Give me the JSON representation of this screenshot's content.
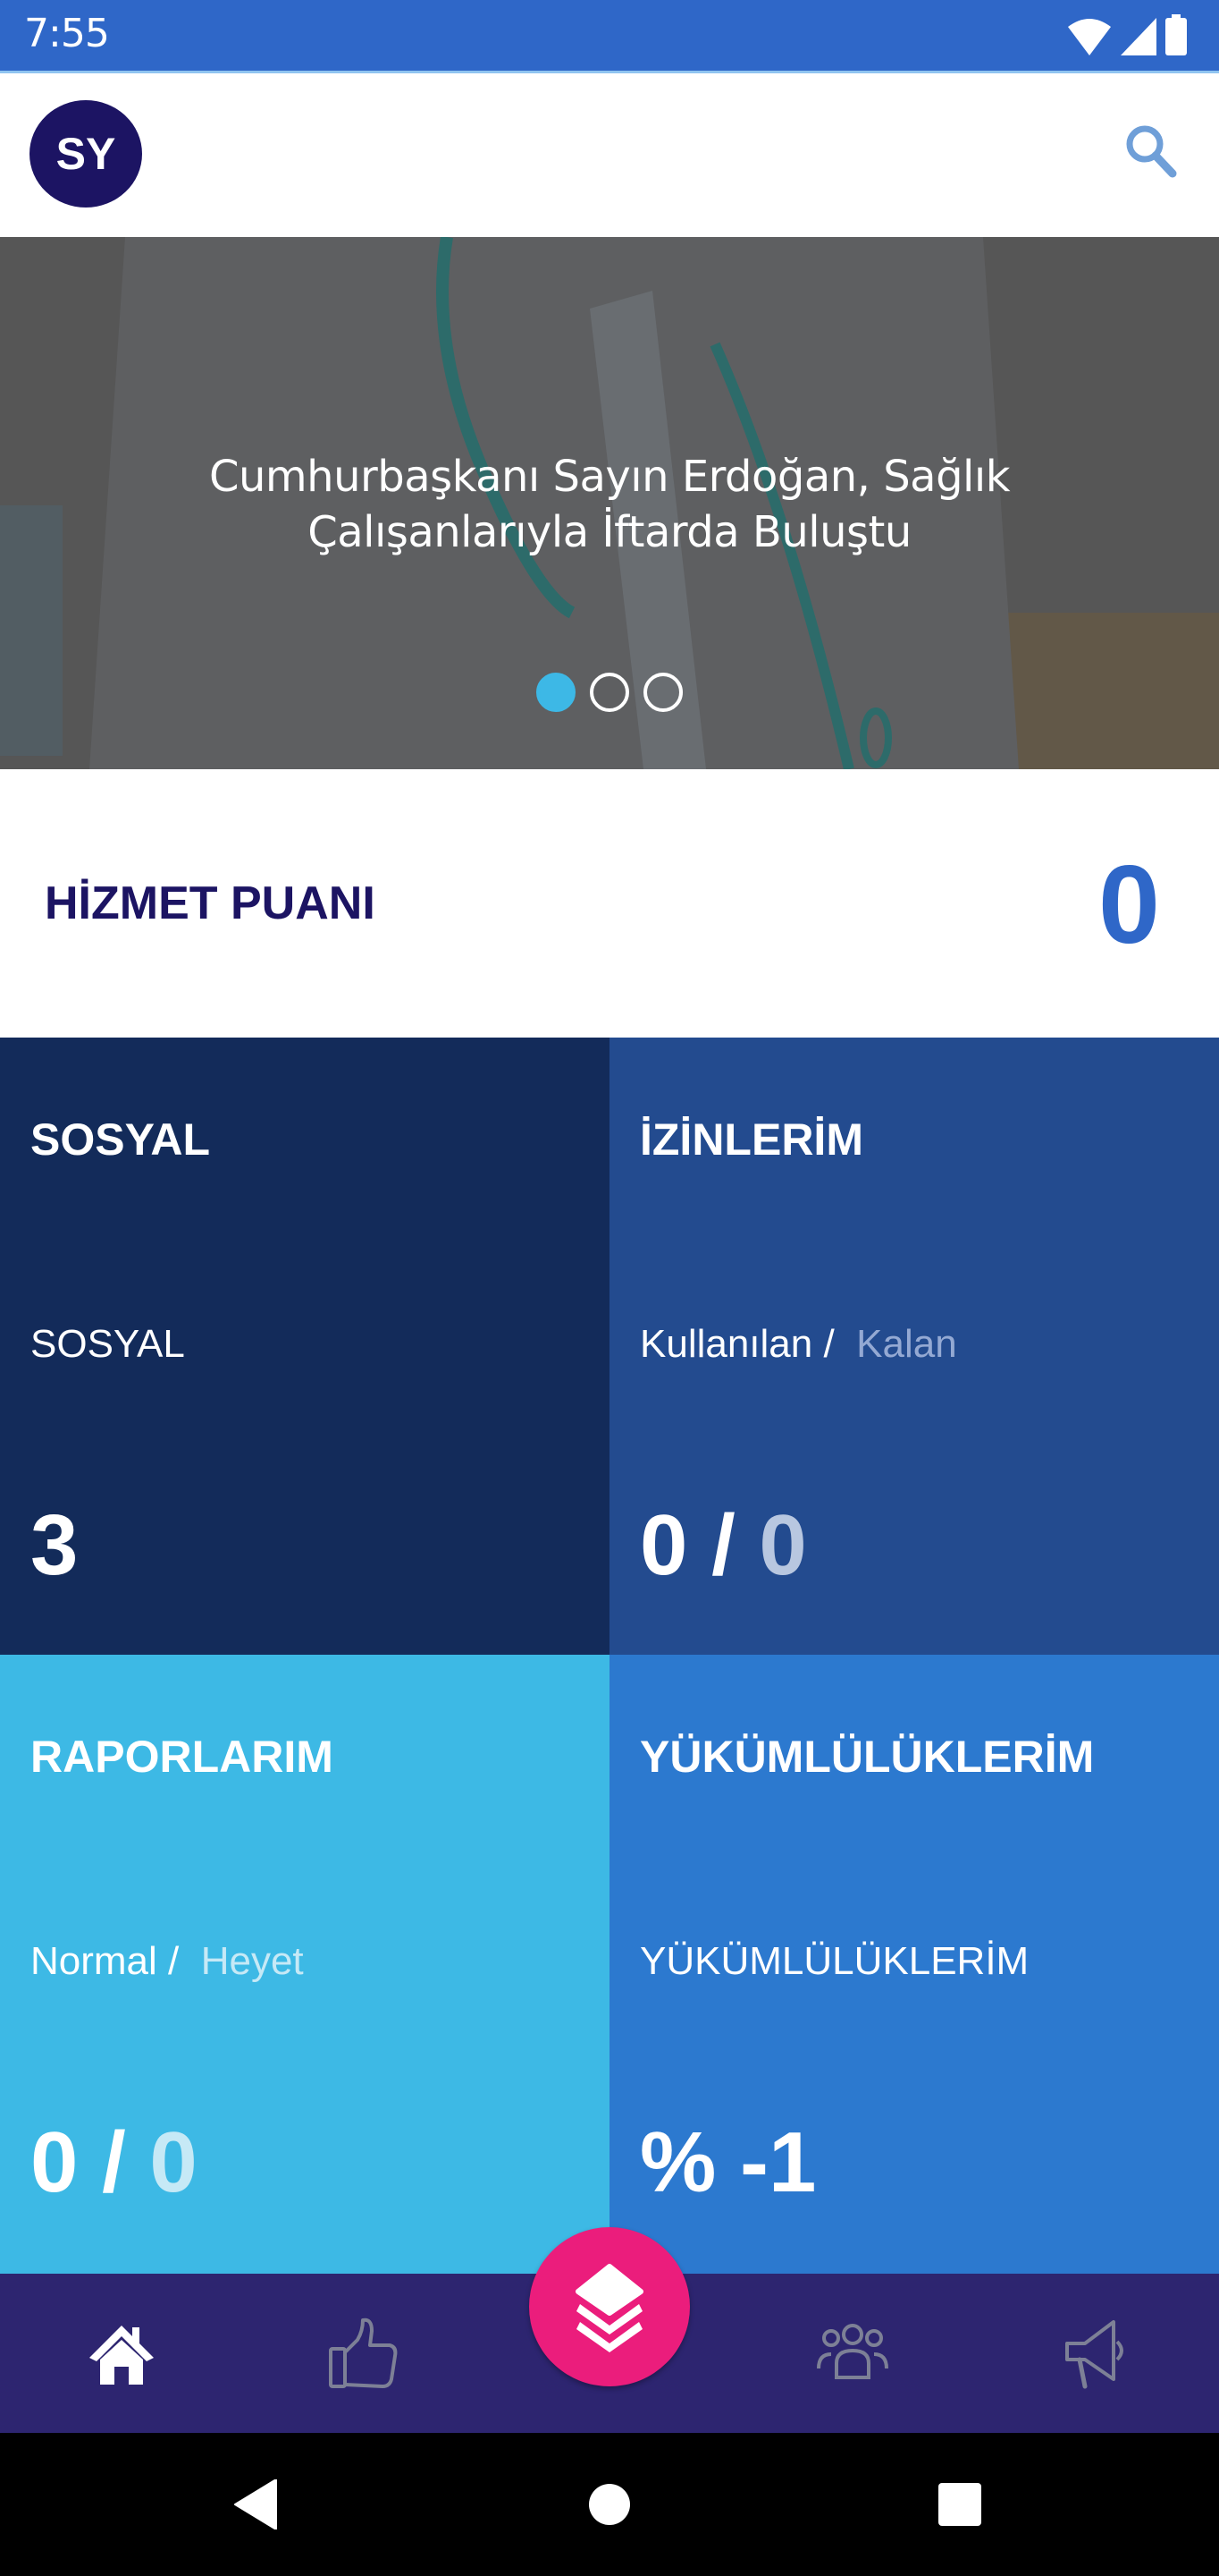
{
  "status_bar": {
    "time": "7:55",
    "icons": [
      "wifi-icon",
      "signal-icon",
      "battery-icon"
    ]
  },
  "app_bar": {
    "avatar_initials": "SY",
    "search_icon": "search-icon"
  },
  "banner": {
    "title_line1": "Cumhurbaşkanı Sayın Erdoğan, Sağlık",
    "title_line2": "Çalışanlarıyla İftarda Buluştu",
    "slide_count": 3,
    "active_slide": 1
  },
  "score": {
    "label": "HİZMET PUANI",
    "value": "0"
  },
  "tiles": [
    {
      "title": "SOSYAL",
      "sub_primary": "SOSYAL",
      "sub_secondary": "",
      "value_primary": "3",
      "value_sep": "",
      "value_secondary": "",
      "color": "#132b5a"
    },
    {
      "title": "İZİNLERİM",
      "sub_primary": "Kullanılan /",
      "sub_secondary": "Kalan",
      "value_primary": "0",
      "value_sep": " / ",
      "value_secondary": "0",
      "color": "#234b8f"
    },
    {
      "title": "RAPORLARIM",
      "sub_primary": "Normal /",
      "sub_secondary": "Heyet",
      "value_primary": "0",
      "value_sep": " / ",
      "value_secondary": "0",
      "color": "#3db9e5"
    },
    {
      "title": "YÜKÜMLÜLÜKLERİM",
      "sub_primary": "YÜKÜMLÜLÜKLERİM",
      "sub_secondary": "",
      "value_primary": "% -1",
      "value_sep": "",
      "value_secondary": "",
      "color": "#2c79cf"
    }
  ],
  "bottom_nav": {
    "items": [
      {
        "icon": "home-icon",
        "active": true
      },
      {
        "icon": "thumbs-up-icon",
        "active": false
      },
      {
        "icon": "layers-icon",
        "active": false,
        "fab": true
      },
      {
        "icon": "group-icon",
        "active": false
      },
      {
        "icon": "megaphone-icon",
        "active": false
      }
    ]
  },
  "system_nav": [
    "back-icon",
    "home-circle-icon",
    "recents-icon"
  ],
  "colors": {
    "status_bar": "#2f67c8",
    "primary_dark": "#1c1463",
    "accent_blue": "#2f67c8",
    "fab": "#eb1d7c",
    "bottom_nav": "#2d2570",
    "dot_active": "#3db8e6"
  }
}
